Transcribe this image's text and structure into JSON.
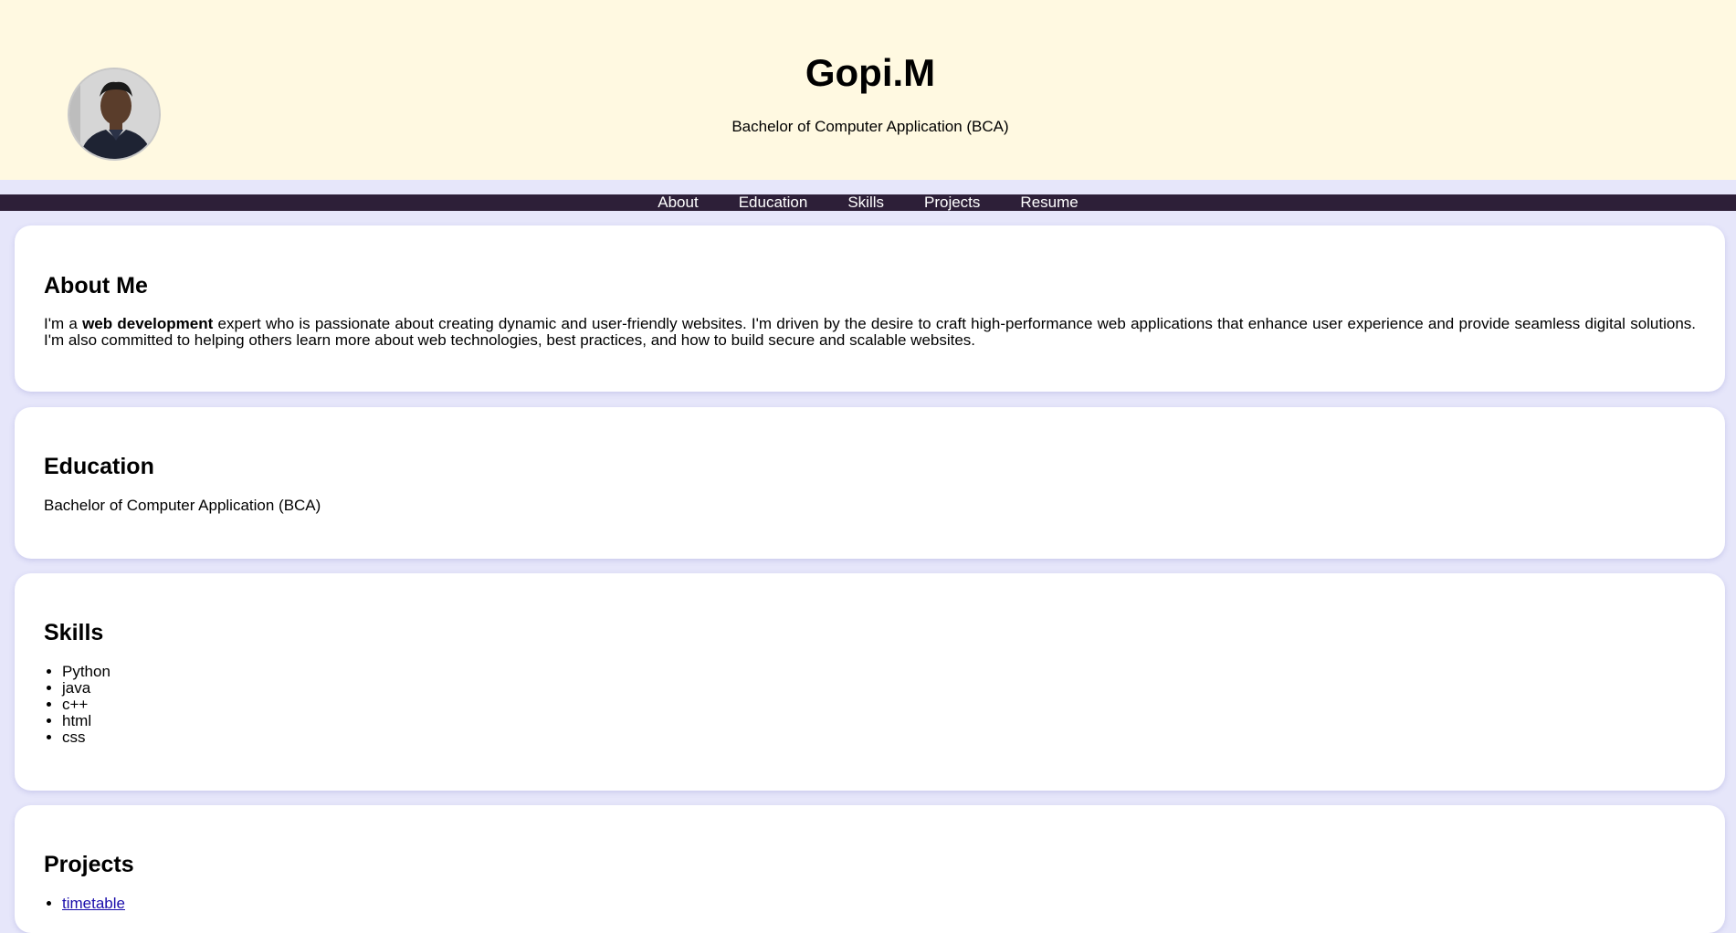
{
  "header": {
    "name": "Gopi.M",
    "degree": "Bachelor of Computer Application (BCA)"
  },
  "nav": {
    "items": [
      "About",
      "Education",
      "Skills",
      "Projects",
      "Resume"
    ]
  },
  "about": {
    "heading": "About Me",
    "text_prefix": "I'm a ",
    "text_bold": "web development",
    "text_suffix": " expert who is passionate about creating dynamic and user-friendly websites. I'm driven by the desire to craft high-performance web applications that enhance user experience and provide seamless digital solutions. I'm also committed to helping others learn more about web technologies, best practices, and how to build secure and scalable websites."
  },
  "education": {
    "heading": "Education",
    "text": "Bachelor of Computer Application (BCA)"
  },
  "skills": {
    "heading": "Skills",
    "items": [
      "Python",
      "java",
      "c++",
      "html",
      "css"
    ]
  },
  "projects": {
    "heading": "Projects",
    "items": [
      "timetable"
    ]
  },
  "colors": {
    "header_bg": "#fff9e1",
    "page_bg": "#e6e6fa",
    "nav_bg": "#2d1f38",
    "link": "#1a0dab"
  }
}
